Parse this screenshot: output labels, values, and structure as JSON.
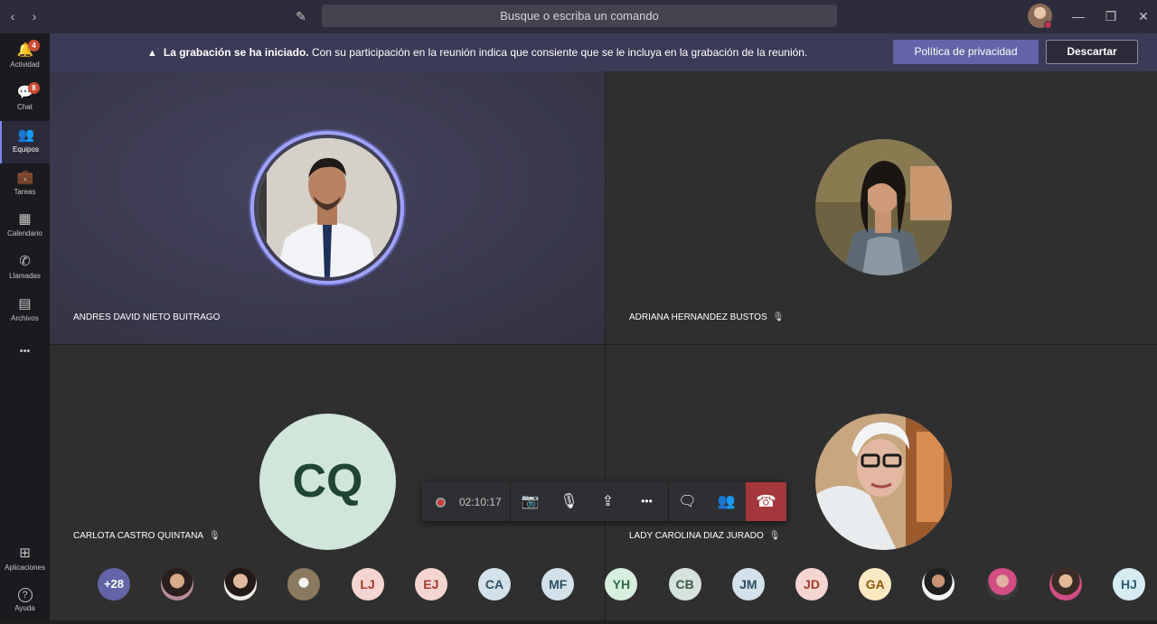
{
  "titlebar": {
    "search_placeholder": "Busque o escriba un comando",
    "back_glyph": "‹",
    "forward_glyph": "›",
    "compose_glyph": "✎",
    "minimize_glyph": "—",
    "restore_glyph": "❐",
    "close_glyph": "✕"
  },
  "rail": {
    "items": [
      {
        "label": "Actividad",
        "icon": "bell-icon",
        "glyph": "🔔",
        "badge": "4"
      },
      {
        "label": "Chat",
        "icon": "chat-icon",
        "glyph": "💬",
        "badge": "8"
      },
      {
        "label": "Equipos",
        "icon": "teams-icon",
        "glyph": "👥",
        "badge": ""
      },
      {
        "label": "Tareas",
        "icon": "tasks-icon",
        "glyph": "💼",
        "badge": ""
      },
      {
        "label": "Calendario",
        "icon": "calendar-icon",
        "glyph": "▦",
        "badge": ""
      },
      {
        "label": "Llamadas",
        "icon": "phone-icon",
        "glyph": "✆",
        "badge": ""
      },
      {
        "label": "Archivos",
        "icon": "files-icon",
        "glyph": "▤",
        "badge": ""
      }
    ],
    "more_glyph": "•••",
    "apps_label": "Aplicaciones",
    "apps_glyph": "⊞",
    "help_label": "Ayuda",
    "help_glyph": "?"
  },
  "banner": {
    "bold_text": "La grabación se ha iniciado.",
    "text": " Con su participación en la reunión indica que consiente que se le incluya en la grabación de la reunión.",
    "warn_glyph": "▲",
    "privacy_button": "Política de privacidad",
    "dismiss_button": "Descartar"
  },
  "participants": [
    {
      "name": "ANDRES DAVID NIETO BUITRAGO",
      "muted": false
    },
    {
      "name": "ADRIANA HERNANDEZ BUSTOS",
      "muted": true
    },
    {
      "name": "CARLOTA CASTRO QUINTANA",
      "muted": true,
      "initials": "CQ"
    },
    {
      "name": "LADY CAROLINA DIAZ JURADO",
      "muted": true
    }
  ],
  "mute_glyph": "🎙",
  "controls": {
    "timer": "02:10:17",
    "camera_glyph": "📷",
    "mic_glyph": "🎙",
    "share_glyph": "⇪",
    "more_glyph": "•••",
    "chat_glyph": "🗨",
    "people_glyph": "👥",
    "hangup_glyph": "☎"
  },
  "attendees": {
    "overflow": "+28",
    "list": [
      {
        "initials": "",
        "kind": "photo"
      },
      {
        "initials": "",
        "kind": "photo"
      },
      {
        "initials": "",
        "kind": "photo"
      },
      {
        "initials": "LJ",
        "bg": "#f6d5d0",
        "fg": "#a33a2e"
      },
      {
        "initials": "EJ",
        "bg": "#f6d5d0",
        "fg": "#a33a2e"
      },
      {
        "initials": "CA",
        "bg": "#d3e2ea",
        "fg": "#2d4f63"
      },
      {
        "initials": "MF",
        "bg": "#d3e2ea",
        "fg": "#2d4f63"
      },
      {
        "initials": "YH",
        "bg": "#d7efdf",
        "fg": "#2f6b44"
      },
      {
        "initials": "CB",
        "bg": "#d6e2dc",
        "fg": "#3b5a4a"
      },
      {
        "initials": "JM",
        "bg": "#d3e2ea",
        "fg": "#2d4f63"
      },
      {
        "initials": "JD",
        "bg": "#f6d5d0",
        "fg": "#a33a2e"
      },
      {
        "initials": "GA",
        "bg": "#fbe9c2",
        "fg": "#8a5c0a"
      },
      {
        "initials": "",
        "kind": "photo"
      },
      {
        "initials": "",
        "kind": "photo"
      },
      {
        "initials": "",
        "kind": "photo"
      },
      {
        "initials": "HJ",
        "bg": "#d6ecf3",
        "fg": "#2f5f73"
      }
    ]
  }
}
